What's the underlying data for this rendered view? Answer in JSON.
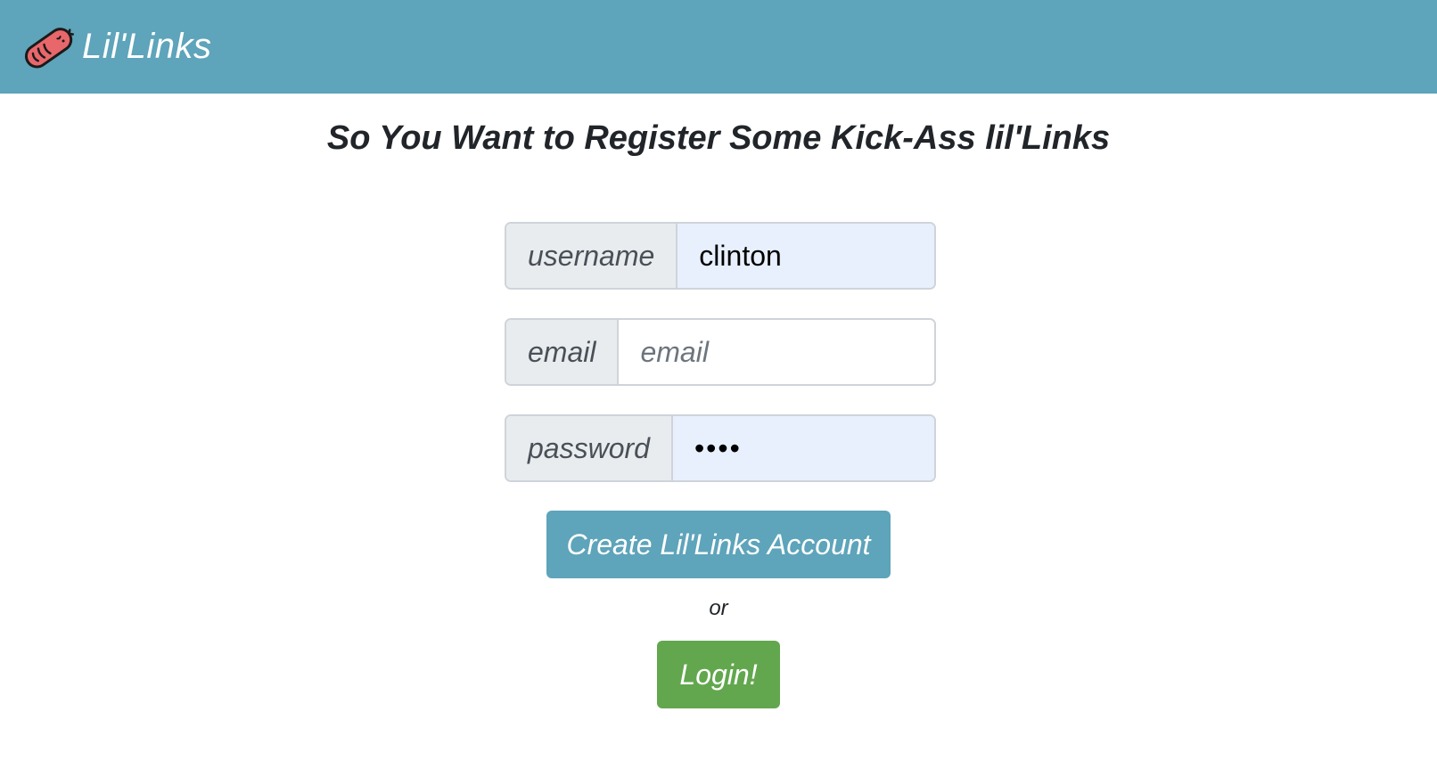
{
  "navbar": {
    "brand_name": "Lil'Links",
    "logo_icon": "sausage-icon",
    "background_color": "#5ea4ba"
  },
  "page": {
    "title": "So You Want to Register Some Kick-Ass lil'Links"
  },
  "form": {
    "username": {
      "label": "username",
      "value": "clinton",
      "placeholder": "username"
    },
    "email": {
      "label": "email",
      "value": "",
      "placeholder": "email"
    },
    "password": {
      "label": "password",
      "value": "••••",
      "placeholder": "password"
    }
  },
  "actions": {
    "create_label": "Create Lil'Links Account",
    "create_color": "#5ea4ba",
    "or_text": "or",
    "login_label": "Login!",
    "login_color": "#62a74e"
  }
}
